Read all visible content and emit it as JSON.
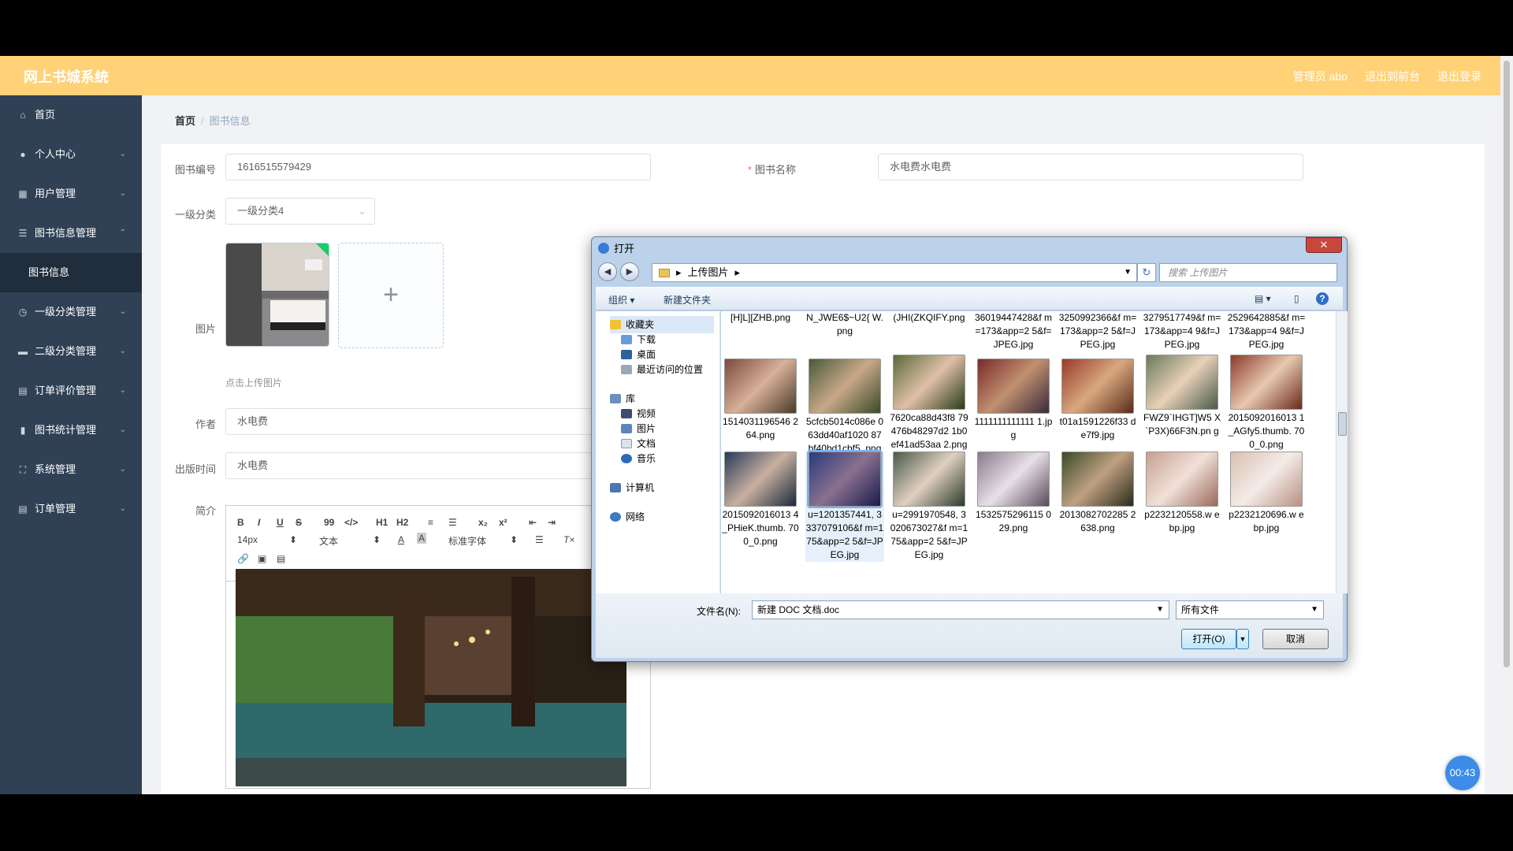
{
  "app": {
    "title": "网上书城系统",
    "header_links": [
      "管理员 abo",
      "退出到前台",
      "退出登录"
    ]
  },
  "sidebar": {
    "items": [
      {
        "label": "首页",
        "icon": "home-icon",
        "expandable": false
      },
      {
        "label": "个人中心",
        "icon": "user-icon",
        "expandable": true
      },
      {
        "label": "用户管理",
        "icon": "grid-icon",
        "expandable": true
      },
      {
        "label": "图书信息管理",
        "icon": "list-icon",
        "expandable": true,
        "expanded": true
      },
      {
        "label": "图书信息",
        "icon": "",
        "sub": true
      },
      {
        "label": "一级分类管理",
        "icon": "clock-icon",
        "expandable": true
      },
      {
        "label": "二级分类管理",
        "icon": "monitor-icon",
        "expandable": true
      },
      {
        "label": "订单评价管理",
        "icon": "clipboard-icon",
        "expandable": true
      },
      {
        "label": "图书统计管理",
        "icon": "bar-chart-icon",
        "expandable": true
      },
      {
        "label": "系统管理",
        "icon": "frame-icon",
        "expandable": true
      },
      {
        "label": "订单管理",
        "icon": "clipboard-icon",
        "expandable": true
      }
    ]
  },
  "breadcrumb": {
    "home": "首页",
    "separator": "/",
    "current": "图书信息"
  },
  "form": {
    "book_no_label": "图书编号",
    "book_no_value": "1616515579429",
    "book_name_label": "图书名称",
    "book_name_value": "水电费水电费",
    "category_label": "一级分类",
    "category_value": "一级分类4",
    "image_label": "图片",
    "upload_tip": "点击上传图片",
    "author_label": "作者",
    "author_value": "水电费",
    "publish_label": "出版时间",
    "publish_value": "水电费",
    "intro_label": "简介"
  },
  "editor": {
    "toolbar_row1": [
      "B",
      "I",
      "U",
      "S",
      "99",
      "</>",
      "H1",
      "H2",
      "≡",
      "☰",
      "x₂",
      "x²",
      "⇤",
      "⇥"
    ],
    "font_size": "14px",
    "font_type": "文本",
    "font_family": "标准字体"
  },
  "dialog": {
    "title": "打开",
    "path": "上传图片",
    "search_placeholder": "搜索 上传图片",
    "organize": "组织 ▾",
    "new_folder": "新建文件夹",
    "nav": [
      {
        "label": "收藏夹",
        "icon": "star-icon",
        "level": 0
      },
      {
        "label": "下载",
        "icon": "download-folder-icon",
        "level": 1
      },
      {
        "label": "桌面",
        "icon": "desktop-icon",
        "level": 1
      },
      {
        "label": "最近访问的位置",
        "icon": "recent-places-icon",
        "level": 1
      },
      {
        "label": "库",
        "icon": "library-icon",
        "level": 0
      },
      {
        "label": "视频",
        "icon": "video-icon",
        "level": 1
      },
      {
        "label": "图片",
        "icon": "pictures-icon",
        "level": 1
      },
      {
        "label": "文档",
        "icon": "documents-icon",
        "level": 1
      },
      {
        "label": "音乐",
        "icon": "music-icon",
        "level": 1
      },
      {
        "label": "计算机",
        "icon": "computer-icon",
        "level": 0
      },
      {
        "label": "网络",
        "icon": "network-icon",
        "level": 0
      }
    ],
    "top_partial_files": [
      "[H]L][ZHB.png",
      "N_JWE6$~U2{ W.png",
      "(JHI(ZKQIFY.png",
      "36019447428&f m=173&app=2 5&f=JPEG.jpg",
      "3250992366&f m=173&app=2 5&f=JPEG.jpg",
      "3279517749&f m=173&app=4 9&f=JPEG.jpg",
      "2529642885&f m=173&app=4 9&f=JPEG.jpg"
    ],
    "files_row1": [
      "1514031196546 264.png",
      "5cfcb5014c086e 063dd40af1020 87bf40bd1cbf5. png",
      "7620ca88d43f8 79476b48297d2 1b0ef41ad53aa 2.png",
      "1111111111111 1.jpg",
      "t01a1591226f33 de7f9.jpg",
      "FWZ9`IHGT]W5 X`P3X)66F3N.pn g",
      "2015092016013 1_AGfy5.thumb. 700_0.png"
    ],
    "files_row2": [
      "2015092016013 4_PHieK.thumb. 700_0.png",
      "u=1201357441, 3337079106&f m=175&app=2 5&f=JPEG.jpg",
      "u=2991970548, 3020673027&f m=175&app=2 5&f=JPEG.jpg",
      "1532575296115 029.png",
      "2013082702285 2638.png",
      "p2232120558.w ebp.jpg",
      "p2232120696.w ebp.jpg"
    ],
    "filename_label": "文件名(N):",
    "filename_value": "新建 DOC 文档.doc",
    "filetype_value": "所有文件",
    "open_button": "打开(O)",
    "cancel_button": "取消"
  },
  "timer": "00:43",
  "colors": {
    "header": "#ffd277",
    "sidebar": "#304156",
    "accent": "#3c8ce8"
  }
}
